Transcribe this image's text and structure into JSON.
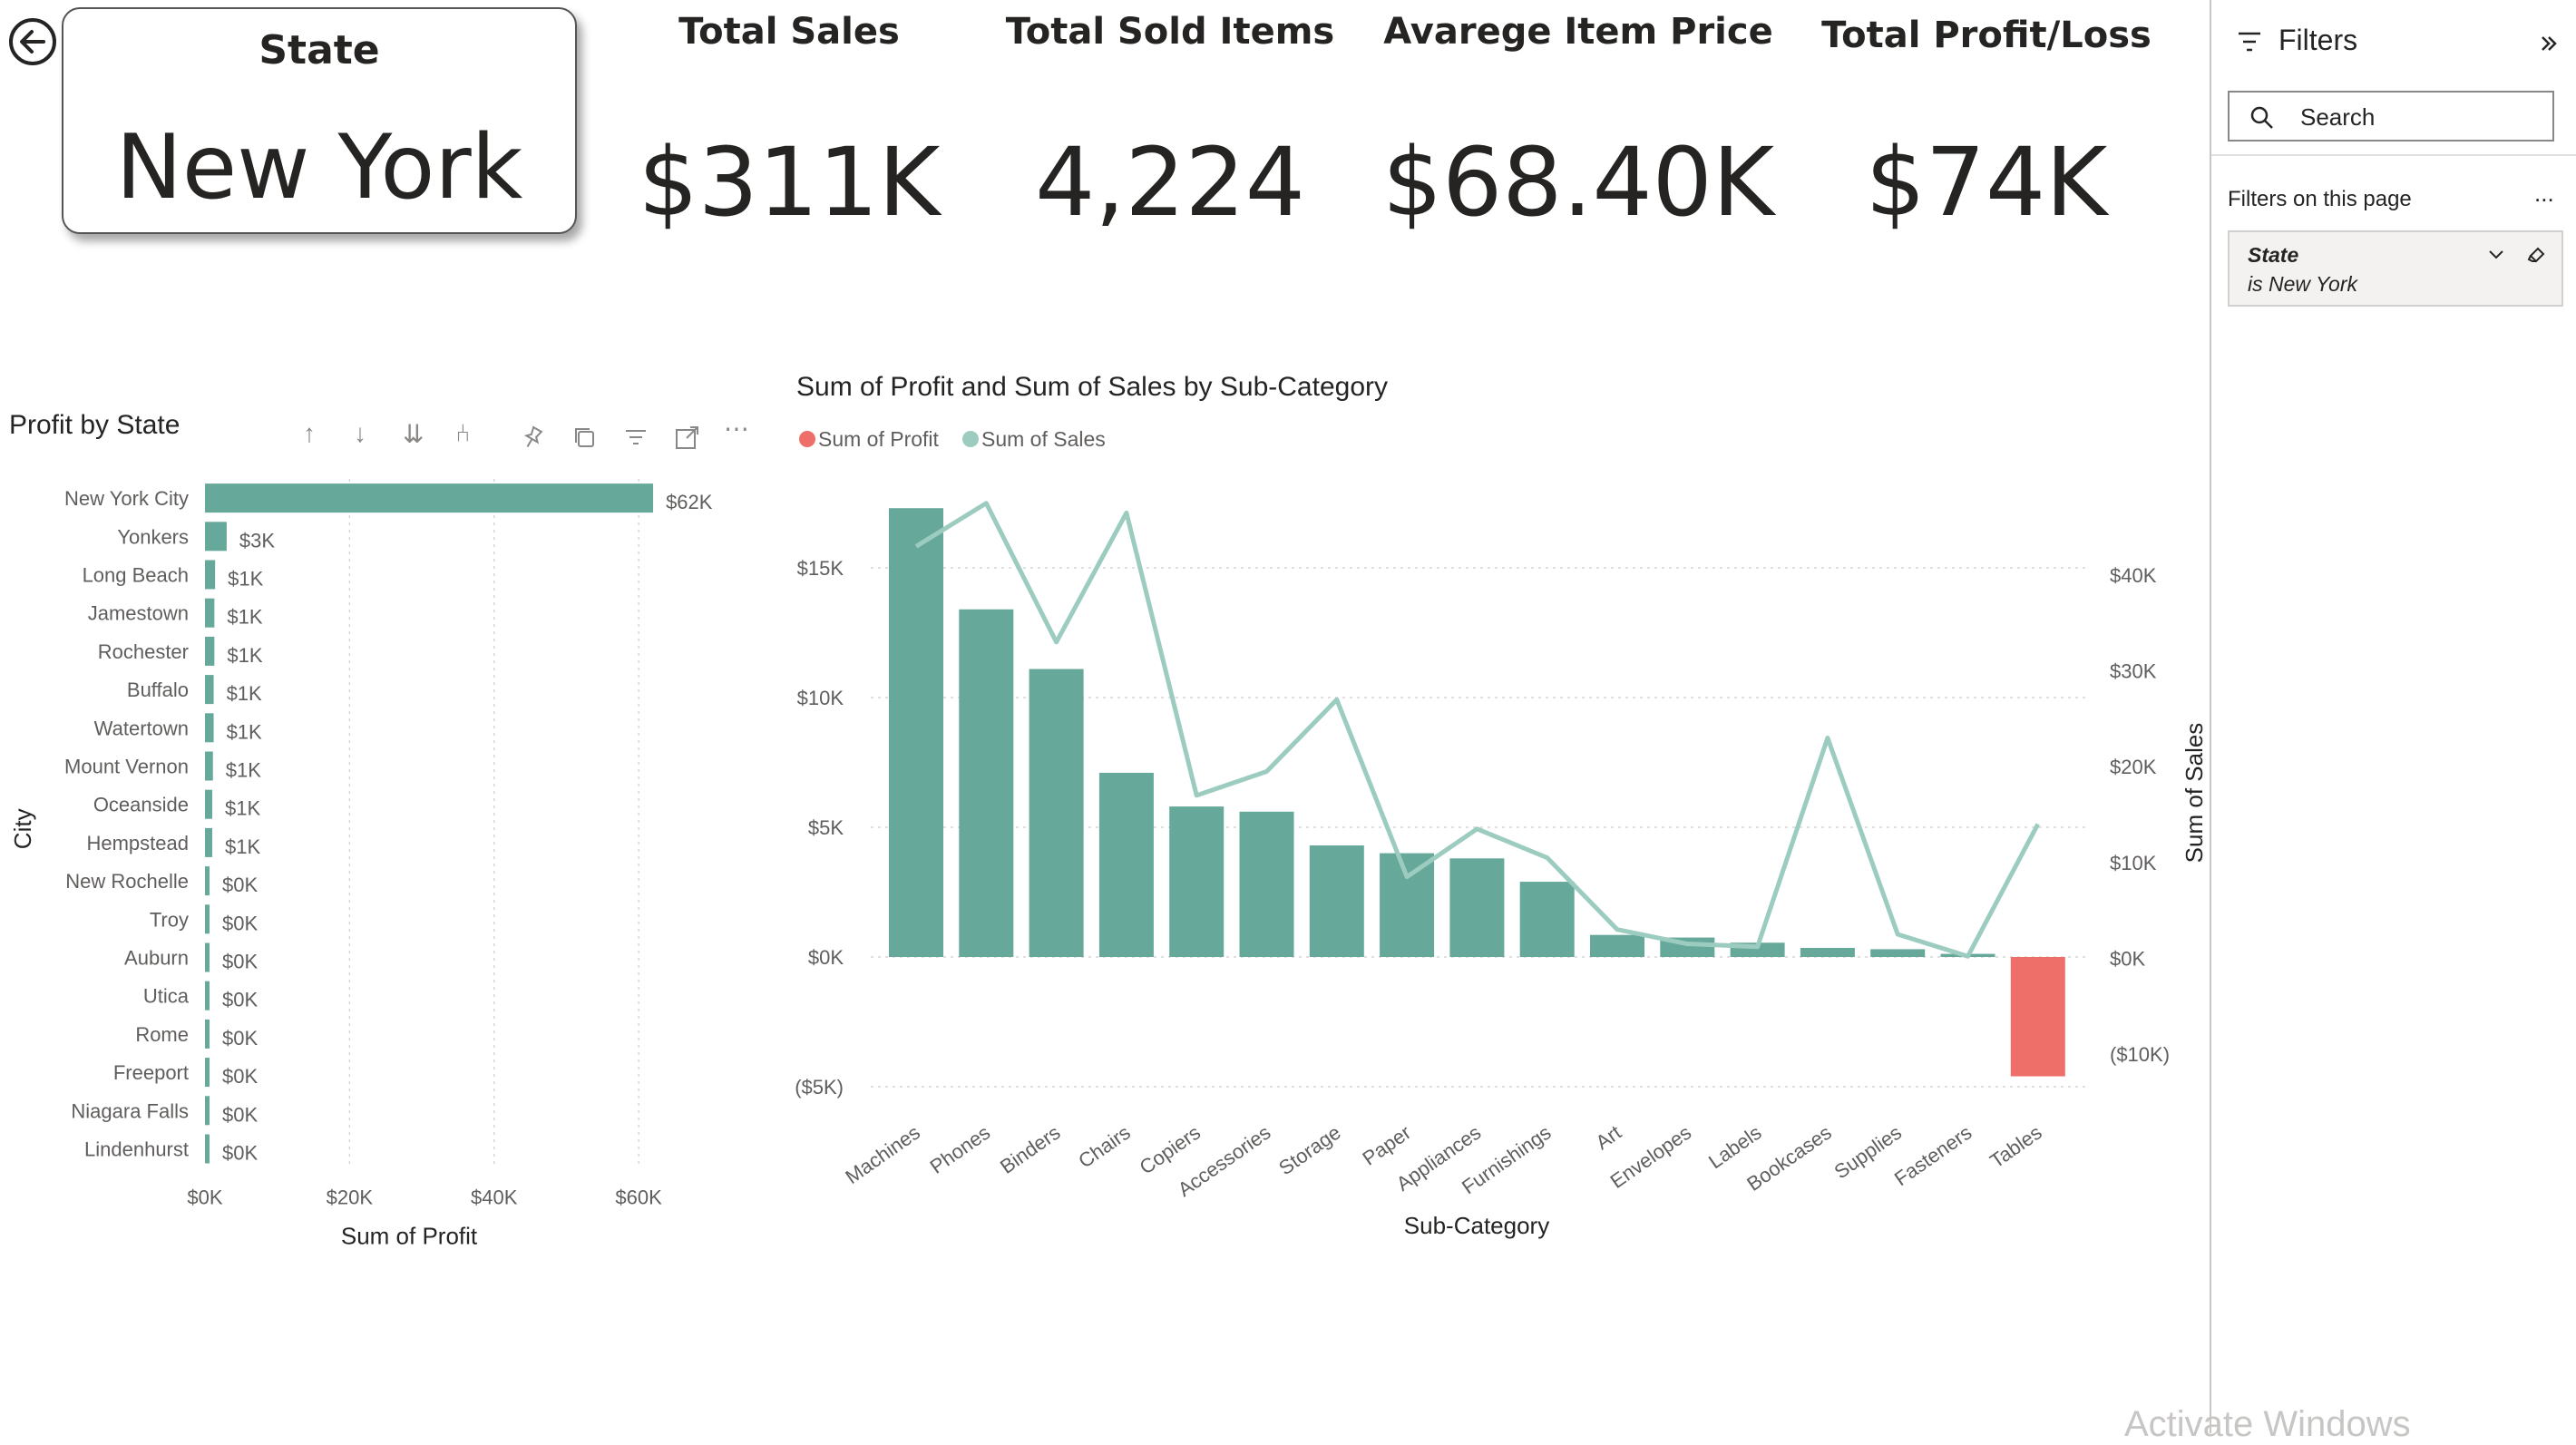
{
  "state_card": {
    "label": "State",
    "value": "New York"
  },
  "kpis": [
    {
      "title": "Total Sales",
      "value": "$311K"
    },
    {
      "title": "Total Sold Items",
      "value": "4,224"
    },
    {
      "title": "Avarege Item Price",
      "value": "$68.40K"
    },
    {
      "title": "Total Profit/Loss",
      "value": "$74K"
    }
  ],
  "filters": {
    "header": "Filters",
    "search_placeholder": "Search",
    "section": "Filters on this page",
    "more": "...",
    "card": {
      "field": "State",
      "condition": "is New York"
    }
  },
  "left_chart_title": "Profit by State",
  "right_chart_title": "Sum of Profit and Sum of Sales by Sub-Category",
  "watermark": "Activate Windows",
  "colors": {
    "bar": "#66a89a",
    "line": "#9cccc0",
    "negative": "#ee6e6a",
    "grid": "#d6d6d6"
  },
  "chart_data": [
    {
      "type": "bar",
      "orientation": "horizontal",
      "title": "Profit by State",
      "xlabel": "Sum of Profit",
      "ylabel": "City",
      "categories": [
        "New York City",
        "Yonkers",
        "Long Beach",
        "Jamestown",
        "Rochester",
        "Buffalo",
        "Watertown",
        "Mount Vernon",
        "Oceanside",
        "Hempstead",
        "New Rochelle",
        "Troy",
        "Auburn",
        "Utica",
        "Rome",
        "Freeport",
        "Niagara Falls",
        "Lindenhurst"
      ],
      "values": [
        62000,
        3000,
        1400,
        1300,
        1300,
        1200,
        1200,
        1100,
        1000,
        1000,
        400,
        300,
        300,
        300,
        250,
        250,
        250,
        250
      ],
      "data_labels": [
        "$62K",
        "$3K",
        "$1K",
        "$1K",
        "$1K",
        "$1K",
        "$1K",
        "$1K",
        "$1K",
        "$1K",
        "$0K",
        "$0K",
        "$0K",
        "$0K",
        "$0K",
        "$0K",
        "$0K",
        "$0K"
      ],
      "xticks": [
        "$0K",
        "$20K",
        "$40K",
        "$60K"
      ],
      "xlim": [
        0,
        64000
      ],
      "grid": true
    },
    {
      "type": "bar+line",
      "title": "Sum of Profit and Sum of Sales by Sub-Category",
      "xlabel": "Sub-Category",
      "y2label": "Sum of Sales",
      "categories": [
        "Machines",
        "Phones",
        "Binders",
        "Chairs",
        "Copiers",
        "Accessories",
        "Storage",
        "Paper",
        "Appliances",
        "Furnishings",
        "Art",
        "Envelopes",
        "Labels",
        "Bookcases",
        "Supplies",
        "Fasteners",
        "Tables"
      ],
      "series": [
        {
          "name": "Sum of Profit",
          "axis": "left",
          "kind": "bar",
          "values": [
            17300,
            13400,
            11100,
            7100,
            5800,
            5600,
            4300,
            4000,
            3800,
            2900,
            850,
            750,
            550,
            350,
            300,
            120,
            -4600
          ]
        },
        {
          "name": "Sum of Sales",
          "axis": "right",
          "kind": "line",
          "values": [
            43000,
            47500,
            33000,
            46500,
            17000,
            19500,
            27000,
            8500,
            13500,
            10500,
            3000,
            1500,
            1200,
            23000,
            2500,
            200,
            14000
          ]
        }
      ],
      "yticks_left": [
        "($5K)",
        "$0K",
        "$5K",
        "$10K",
        "$15K"
      ],
      "ylim_left": [
        -5000,
        15000
      ],
      "yticks_right": [
        "($10K)",
        "$0K",
        "$10K",
        "$20K",
        "$30K",
        "$40K"
      ],
      "ylim_right": [
        -10000,
        40000
      ],
      "legend": "top-left",
      "grid": true
    }
  ]
}
